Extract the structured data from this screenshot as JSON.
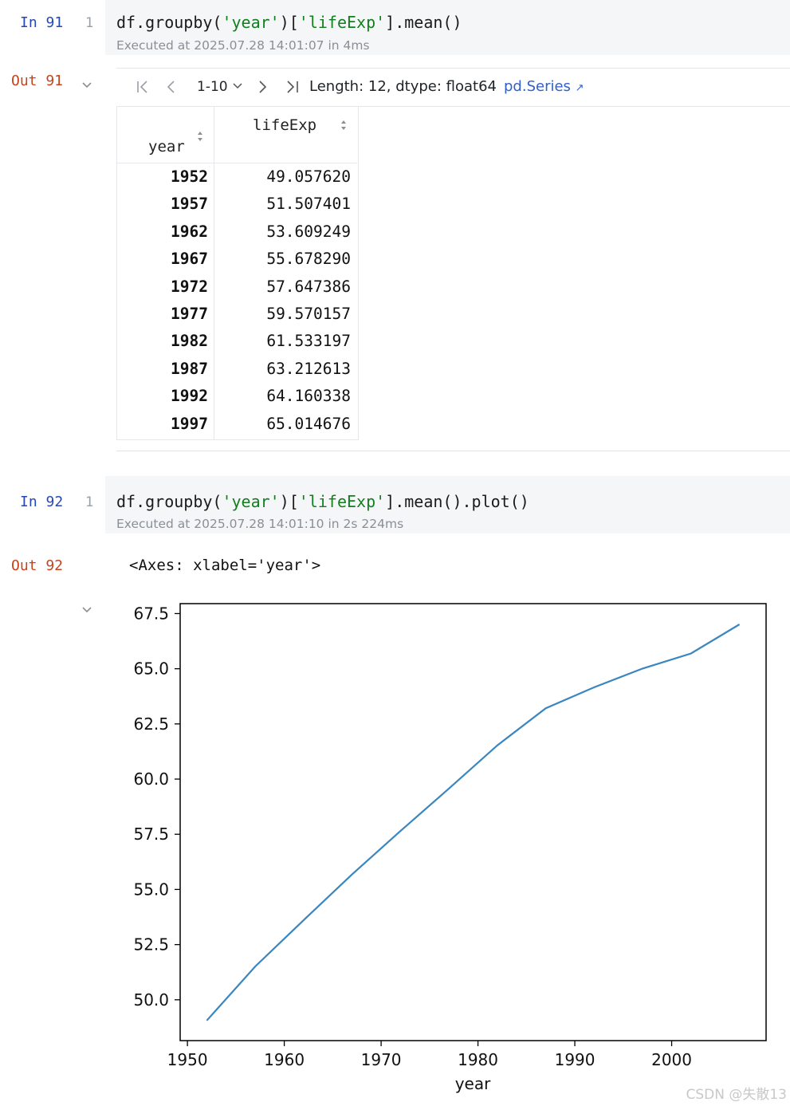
{
  "cell91": {
    "in_prompt": "In 91",
    "line_no": "1",
    "code_parts": [
      "df.groupby(",
      "'year'",
      ")[",
      "'lifeExp'",
      "].mean()"
    ],
    "exec_info": "Executed at 2025.07.28 14:01:07 in 4ms",
    "out_prompt": "Out 91"
  },
  "toolbar": {
    "range": "1-10",
    "info": "Length: 12, dtype: float64",
    "link": "pd.Series"
  },
  "table": {
    "index_header": "year",
    "value_header": "lifeExp",
    "rows": [
      {
        "year": "1952",
        "value": "49.057620"
      },
      {
        "year": "1957",
        "value": "51.507401"
      },
      {
        "year": "1962",
        "value": "53.609249"
      },
      {
        "year": "1967",
        "value": "55.678290"
      },
      {
        "year": "1972",
        "value": "57.647386"
      },
      {
        "year": "1977",
        "value": "59.570157"
      },
      {
        "year": "1982",
        "value": "61.533197"
      },
      {
        "year": "1987",
        "value": "63.212613"
      },
      {
        "year": "1992",
        "value": "64.160338"
      },
      {
        "year": "1997",
        "value": "65.014676"
      }
    ]
  },
  "cell92": {
    "in_prompt": "In 92",
    "line_no": "1",
    "code_parts": [
      "df.groupby(",
      "'year'",
      ")[",
      "'lifeExp'",
      "].mean().plot()"
    ],
    "exec_info": "Executed at 2025.07.28 14:01:10 in 2s 224ms",
    "out_prompt": "Out 92",
    "output_text": "<Axes: xlabel='year'>"
  },
  "watermark": "CSDN @失散13",
  "chart_data": {
    "type": "line",
    "xlabel": "year",
    "ylabel": "",
    "xlim": [
      1949.25,
      2009.75
    ],
    "ylim": [
      48.15,
      67.95
    ],
    "x_ticks": [
      1950,
      1960,
      1970,
      1980,
      1990,
      2000
    ],
    "y_ticks": [
      50.0,
      52.5,
      55.0,
      57.5,
      60.0,
      62.5,
      65.0,
      67.5
    ],
    "x_tick_labels": [
      "1950",
      "1960",
      "1970",
      "1980",
      "1990",
      "2000"
    ],
    "y_tick_labels": [
      "50.0",
      "52.5",
      "55.0",
      "57.5",
      "60.0",
      "62.5",
      "65.0",
      "67.5"
    ],
    "grid": false,
    "color": "#3a86bf",
    "series": [
      {
        "x": [
          1952,
          1957,
          1962,
          1967,
          1972,
          1977,
          1982,
          1987,
          1992,
          1997,
          2002,
          2007
        ],
        "values": [
          49.06,
          51.51,
          53.61,
          55.68,
          57.65,
          59.57,
          61.53,
          63.21,
          64.16,
          65.01,
          65.69,
          67.01
        ]
      }
    ]
  }
}
